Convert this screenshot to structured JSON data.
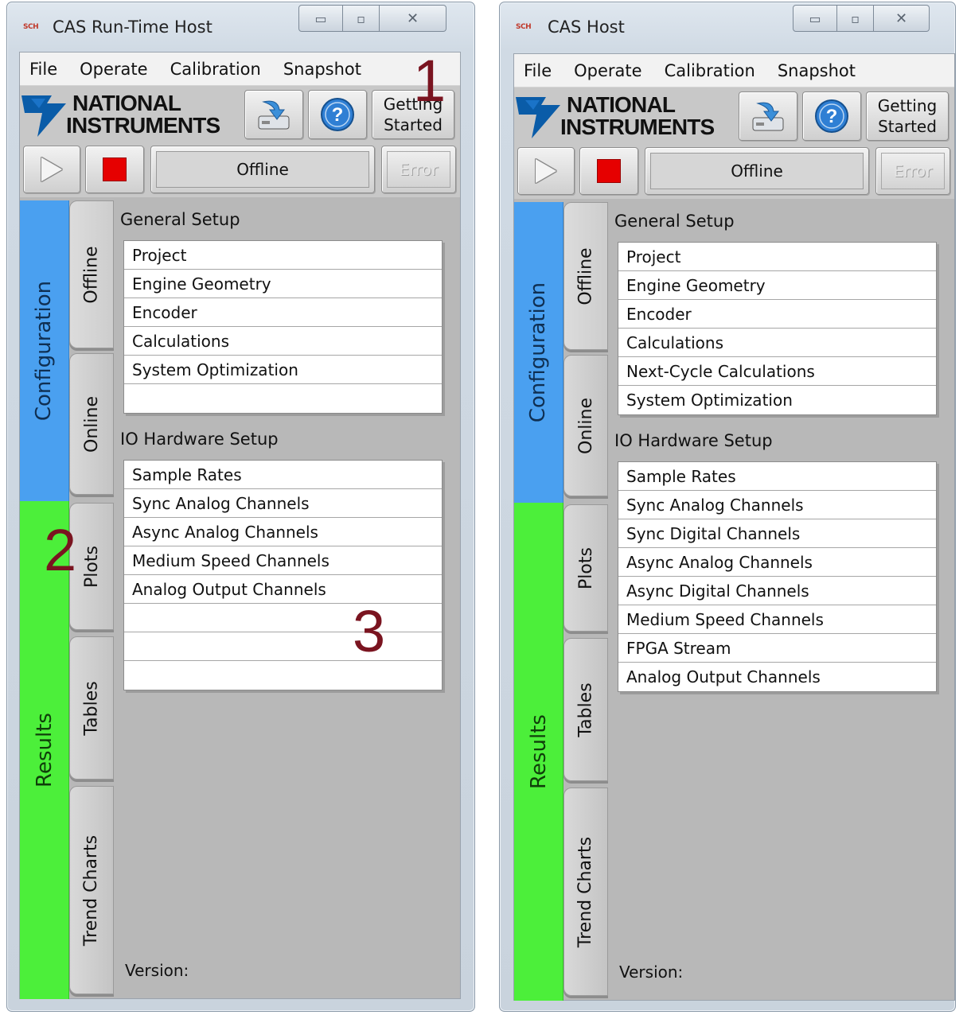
{
  "left_window": {
    "title": "CAS Run-Time Host",
    "app_icon_text": "SCH",
    "menu": [
      "File",
      "Operate",
      "Calibration",
      "Snapshot"
    ],
    "logo": {
      "line1": "NATIONAL",
      "line2": "INSTRUMENTS"
    },
    "getting_started": {
      "line1": "Getting",
      "line2": "Started"
    },
    "status": "Offline",
    "error_label": "Error",
    "sections": {
      "configuration": "Configuration",
      "results": "Results"
    },
    "tabs": {
      "offline": "Offline",
      "online": "Online",
      "plots": "Plots",
      "tables": "Tables",
      "trend_charts": "Trend Charts"
    },
    "general_setup": {
      "label": "General Setup",
      "items": [
        "Project",
        "Engine Geometry",
        "Encoder",
        "Calculations",
        "System Optimization",
        ""
      ]
    },
    "io_setup": {
      "label": "IO Hardware Setup",
      "items": [
        "Sample Rates",
        "Sync Analog Channels",
        "Async Analog Channels",
        "Medium Speed Channels",
        "Analog Output Channels",
        "",
        "",
        ""
      ]
    },
    "version_label": "Version:",
    "callouts": [
      "1",
      "2",
      "3"
    ]
  },
  "right_window": {
    "title": "CAS Host",
    "app_icon_text": "SCH",
    "menu": [
      "File",
      "Operate",
      "Calibration",
      "Snapshot"
    ],
    "logo": {
      "line1": "NATIONAL",
      "line2": "INSTRUMENTS"
    },
    "getting_started": {
      "line1": "Getting",
      "line2": "Started"
    },
    "status": "Offline",
    "error_label": "Error",
    "sections": {
      "configuration": "Configuration",
      "results": "Results"
    },
    "tabs": {
      "offline": "Offline",
      "online": "Online",
      "plots": "Plots",
      "tables": "Tables",
      "trend_charts": "Trend Charts"
    },
    "general_setup": {
      "label": "General Setup",
      "items": [
        "Project",
        "Engine Geometry",
        "Encoder",
        "Calculations",
        "Next-Cycle Calculations",
        "System Optimization"
      ]
    },
    "io_setup": {
      "label": "IO Hardware Setup",
      "items": [
        "Sample Rates",
        "Sync Analog Channels",
        "Sync Digital Channels",
        "Async Analog Channels",
        "Async Digital Channels",
        "Medium Speed Channels",
        "FPGA Stream",
        "Analog Output Channels"
      ]
    },
    "version_label": "Version:"
  },
  "colors": {
    "configuration_tab": "#4aa0f0",
    "results_tab": "#4cef3a",
    "stop_button": "#e60000",
    "callout": "#7a1420",
    "panel_gray": "#b8b8b8"
  },
  "icons": [
    "app-icon",
    "minimize-icon",
    "maximize-icon",
    "close-icon",
    "ni-eagle-icon",
    "save-download-icon",
    "help-icon",
    "run-icon",
    "stop-icon"
  ]
}
